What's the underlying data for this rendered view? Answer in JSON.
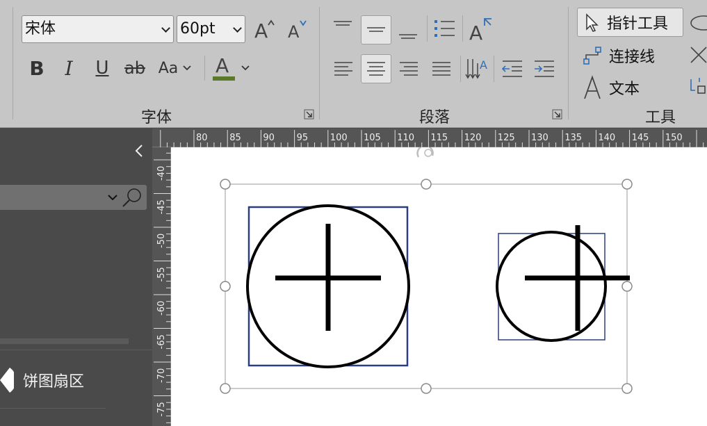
{
  "ribbon": {
    "font_group": {
      "font_name": "宋体",
      "font_size": "60pt",
      "label": "字体",
      "change_case_label": "Aa",
      "bold_label": "B",
      "italic_label": "I",
      "underline_label": "U",
      "strike_label": "ab",
      "font_color_label": "A",
      "font_color": "#5a7a2a"
    },
    "paragraph_group": {
      "label": "段落"
    },
    "tools_group": {
      "label": "工具",
      "pointer_tool": "指针工具",
      "connector_tool": "连接线",
      "text_tool": "文本"
    }
  },
  "ruler": {
    "horizontal": [
      "80",
      "85",
      "90",
      "95",
      "100",
      "105",
      "110",
      "115",
      "120",
      "125",
      "130",
      "135",
      "140",
      "145",
      "150"
    ],
    "vertical": [
      "-40",
      "-45",
      "-50",
      "-55",
      "-60",
      "-65",
      "-70",
      "-75"
    ]
  },
  "left_panel": {
    "shape_item": "饼图扇区"
  },
  "colors": {
    "selection_border": "#2b3e7e",
    "ribbon_bg": "#c6c6c6",
    "panel_bg": "#4a4a4a"
  }
}
